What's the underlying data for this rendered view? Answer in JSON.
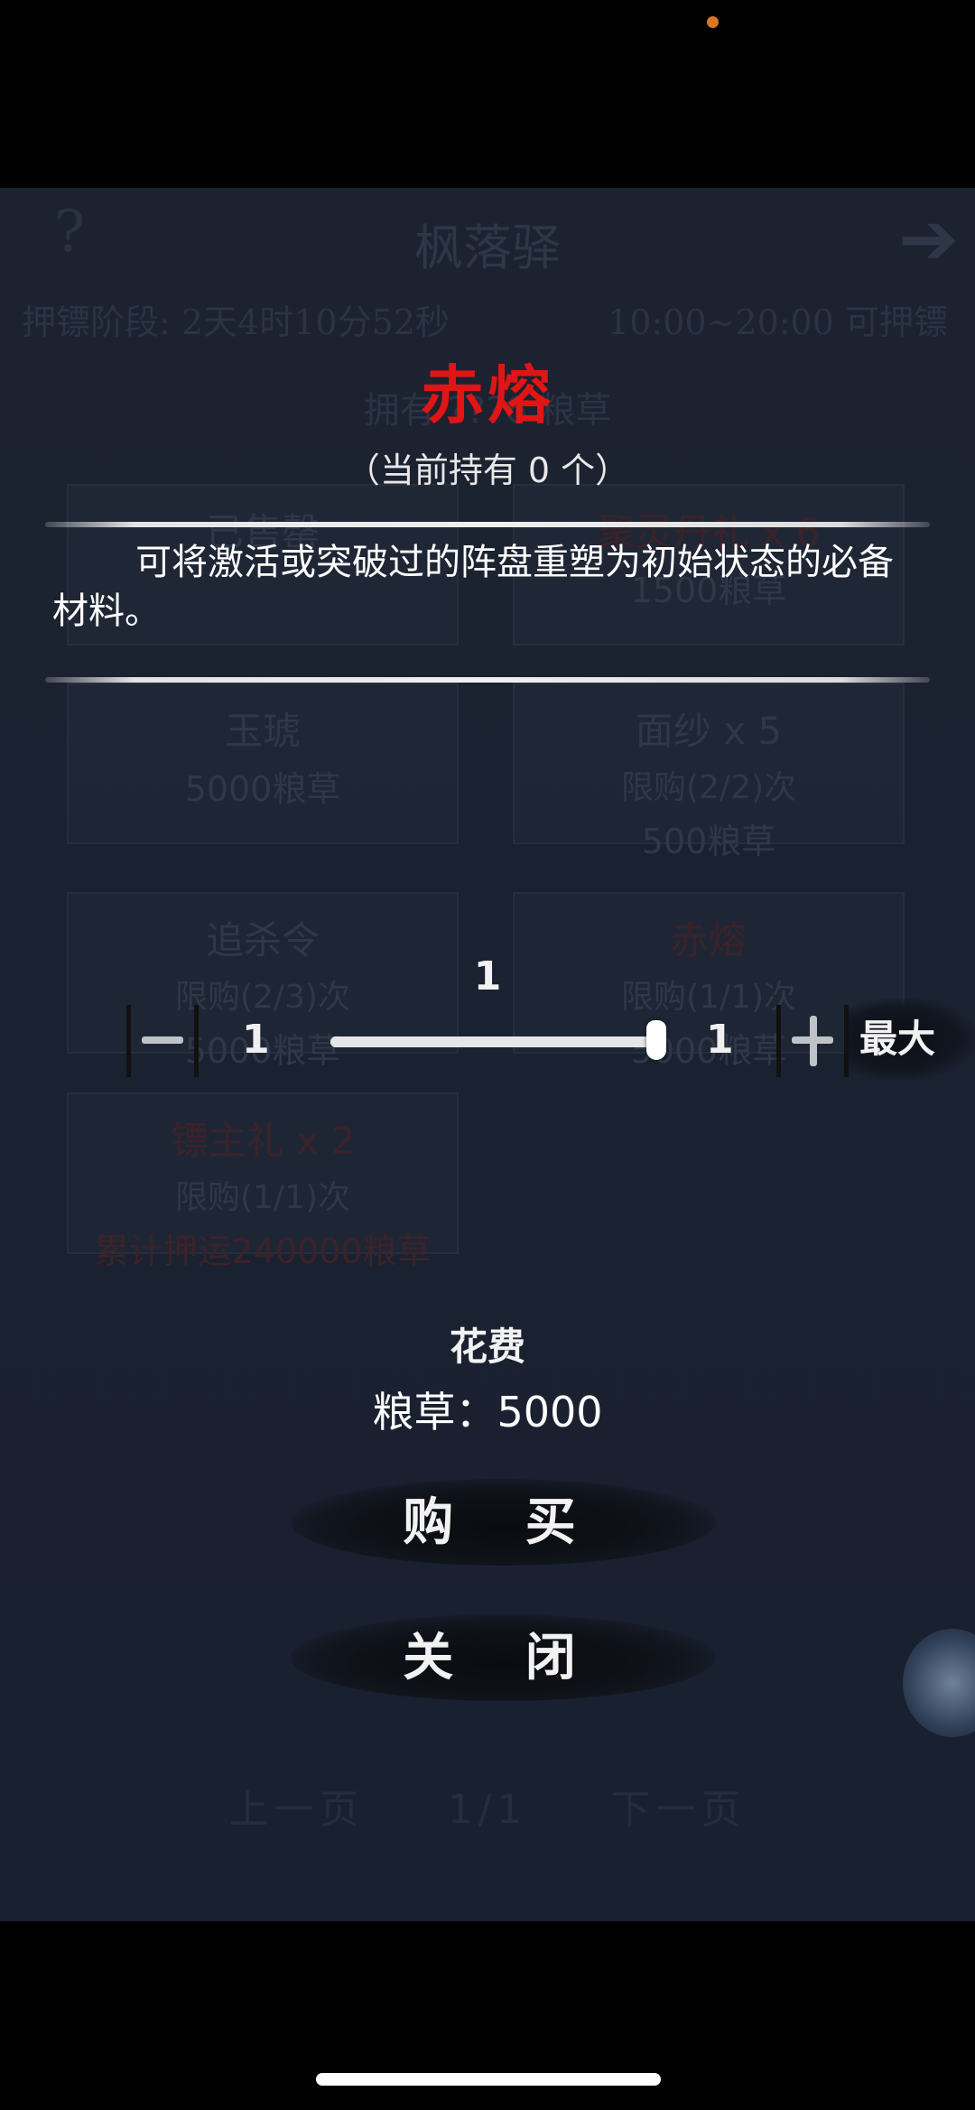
{
  "background": {
    "title": "枫落驿",
    "help_glyph": "?",
    "next_glyph": "➔",
    "stage": "押镖阶段: 2天4时10分52秒",
    "hours": "10:00~20:00 可押镖",
    "owned": "拥有 ???6 粮草",
    "cells": [
      {
        "name": "已售罄",
        "limit": "",
        "price": ""
      },
      {
        "name": "聚灵丹礼 x 6",
        "limit": "",
        "price": "1500粮草"
      },
      {
        "name": "玉琥",
        "limit": "",
        "price": "5000粮草"
      },
      {
        "name": "面纱 x 5",
        "limit": "限购(2/2)次",
        "price": "500粮草"
      },
      {
        "name": "追杀令",
        "limit": "限购(2/3)次",
        "price": "5000粮草"
      },
      {
        "name": "赤熔",
        "limit": "限购(1/1)次",
        "price": "5000粮草"
      },
      {
        "name": "镖主礼 x 2",
        "limit": "限购(1/1)次",
        "price": "累计押运240000粮草"
      }
    ],
    "pager": {
      "prev": "上一页",
      "page": "1/1",
      "next": "下一页"
    }
  },
  "dialog": {
    "item_name": "赤熔",
    "held": "（当前持有 0 个）",
    "description": "可将激活或突破过的阵盘重塑为初始状态的必备材料。",
    "quantity": "1",
    "min_label": "1",
    "max_num": "1",
    "slider_fraction": 1.0,
    "max_label": "最大",
    "cost_title": "花费",
    "cost_line": "粮草：5000",
    "buy_label": "购 买",
    "close_label": "关 闭"
  },
  "colors": {
    "item_name": "#e01515",
    "status_dot": "#d9781f"
  }
}
